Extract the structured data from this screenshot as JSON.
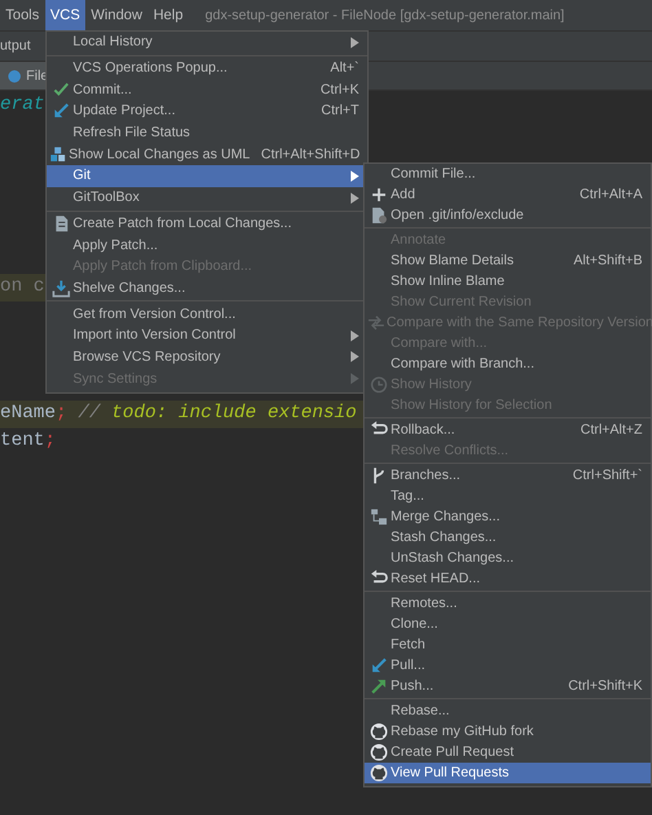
{
  "menubar": [
    {
      "label": "Tools",
      "selected": false
    },
    {
      "label": "VCS",
      "selected": true
    },
    {
      "label": "Window",
      "selected": false
    },
    {
      "label": "Help",
      "selected": false
    }
  ],
  "window": {
    "title": "gdx-setup-generator - FileNode [gdx-setup-generator.main]"
  },
  "breadcrumb": "utput",
  "editor_tab": "File",
  "code": [
    {
      "highlighted": false,
      "segments": [
        {
          "kind": "name",
          "text": "erat"
        }
      ]
    },
    {
      "highlighted": true,
      "segments": [
        {
          "kind": "faded",
          "text": "on c"
        }
      ]
    },
    {
      "highlighted": true,
      "segments": [
        {
          "kind": "plain",
          "text": "eName"
        },
        {
          "kind": "punct",
          "text": ";"
        },
        {
          "kind": "comment",
          "text": " // "
        },
        {
          "kind": "todo",
          "text": "todo: include extensio"
        }
      ]
    },
    {
      "highlighted": false,
      "segments": [
        {
          "kind": "plain",
          "text": "tent"
        },
        {
          "kind": "punct",
          "text": ";"
        }
      ]
    }
  ],
  "vcs_menu": [
    [
      {
        "label": "Local History",
        "submenu": true,
        "disabled": false,
        "selected": false
      }
    ],
    [
      {
        "label": "VCS Operations Popup...",
        "shortcut": "Alt+`",
        "disabled": false,
        "selected": false
      },
      {
        "label": "Commit...",
        "shortcut": "Ctrl+K",
        "kind": "check",
        "disabled": false,
        "selected": false
      },
      {
        "label": "Update Project...",
        "shortcut": "Ctrl+T",
        "kind": "update",
        "disabled": false,
        "selected": false
      },
      {
        "label": "Refresh File Status",
        "disabled": false,
        "selected": false
      },
      {
        "label": "Show Local Changes as UML",
        "shortcut": "Ctrl+Alt+Shift+D",
        "kind": "uml",
        "disabled": false,
        "selected": false
      },
      {
        "label": "Git",
        "submenu": true,
        "disabled": false,
        "selected": true
      },
      {
        "label": "GitToolBox",
        "submenu": true,
        "disabled": false,
        "selected": false
      }
    ],
    [
      {
        "label": "Create Patch from Local Changes...",
        "kind": "patch",
        "disabled": false,
        "selected": false
      },
      {
        "label": "Apply Patch...",
        "disabled": false,
        "selected": false
      },
      {
        "label": "Apply Patch from Clipboard...",
        "disabled": true,
        "selected": false
      },
      {
        "label": "Shelve Changes...",
        "kind": "shelve",
        "disabled": false,
        "selected": false
      }
    ],
    [
      {
        "label": "Get from Version Control...",
        "disabled": false,
        "selected": false
      },
      {
        "label": "Import into Version Control",
        "submenu": true,
        "disabled": false,
        "selected": false
      },
      {
        "label": "Browse VCS Repository",
        "submenu": true,
        "disabled": false,
        "selected": false
      },
      {
        "label": "Sync Settings",
        "submenu": true,
        "disabled": true,
        "selected": false
      }
    ]
  ],
  "git_menu": [
    [
      {
        "label": "Commit File...",
        "disabled": false,
        "selected": false
      },
      {
        "label": "Add",
        "shortcut": "Ctrl+Alt+A",
        "kind": "plus",
        "disabled": false,
        "selected": false
      },
      {
        "label": "Open .git/info/exclude",
        "kind": "file",
        "disabled": false,
        "selected": false
      }
    ],
    [
      {
        "label": "Annotate",
        "disabled": true,
        "selected": false
      },
      {
        "label": "Show Blame Details",
        "shortcut": "Alt+Shift+B",
        "disabled": false,
        "selected": false
      },
      {
        "label": "Show Inline Blame",
        "disabled": false,
        "selected": false
      },
      {
        "label": "Show Current Revision",
        "disabled": true,
        "selected": false
      },
      {
        "label": "Compare with the Same Repository Version",
        "kind": "compare",
        "disabled": true,
        "selected": false
      },
      {
        "label": "Compare with...",
        "disabled": true,
        "selected": false
      },
      {
        "label": "Compare with Branch...",
        "disabled": false,
        "selected": false
      },
      {
        "label": "Show History",
        "kind": "clock",
        "disabled": true,
        "selected": false
      },
      {
        "label": "Show History for Selection",
        "disabled": true,
        "selected": false
      }
    ],
    [
      {
        "label": "Rollback...",
        "shortcut": "Ctrl+Alt+Z",
        "kind": "undo",
        "disabled": false,
        "selected": false
      },
      {
        "label": "Resolve Conflicts...",
        "disabled": true,
        "selected": false
      }
    ],
    [
      {
        "label": "Branches...",
        "shortcut": "Ctrl+Shift+`",
        "kind": "branch",
        "disabled": false,
        "selected": false
      },
      {
        "label": "Tag...",
        "disabled": false,
        "selected": false
      },
      {
        "label": "Merge Changes...",
        "kind": "merge",
        "disabled": false,
        "selected": false
      },
      {
        "label": "Stash Changes...",
        "disabled": false,
        "selected": false
      },
      {
        "label": "UnStash Changes...",
        "disabled": false,
        "selected": false
      },
      {
        "label": "Reset HEAD...",
        "kind": "undo",
        "disabled": false,
        "selected": false
      }
    ],
    [
      {
        "label": "Remotes...",
        "disabled": false,
        "selected": false
      },
      {
        "label": "Clone...",
        "disabled": false,
        "selected": false
      },
      {
        "label": "Fetch",
        "disabled": false,
        "selected": false
      },
      {
        "label": "Pull...",
        "kind": "pull",
        "disabled": false,
        "selected": false
      },
      {
        "label": "Push...",
        "shortcut": "Ctrl+Shift+K",
        "kind": "push",
        "disabled": false,
        "selected": false
      }
    ],
    [
      {
        "label": "Rebase...",
        "disabled": false,
        "selected": false
      },
      {
        "label": "Rebase my GitHub fork",
        "kind": "github",
        "disabled": false,
        "selected": false
      },
      {
        "label": "Create Pull Request",
        "kind": "github",
        "disabled": false,
        "selected": false
      },
      {
        "label": "View Pull Requests",
        "kind": "github",
        "disabled": false,
        "selected": true
      }
    ]
  ]
}
